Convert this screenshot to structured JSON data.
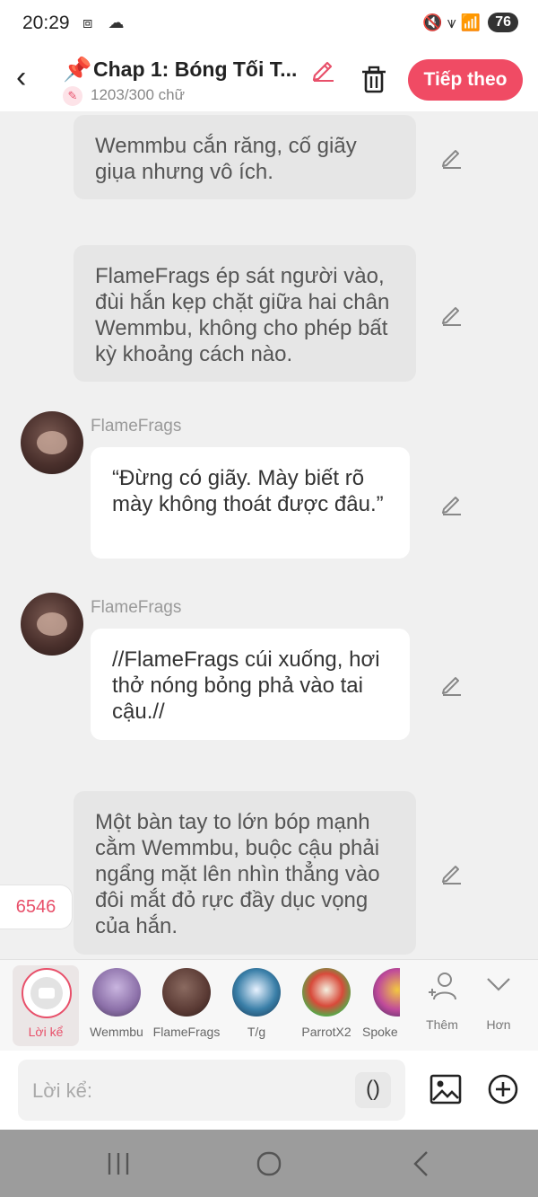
{
  "status": {
    "time": "20:29",
    "left_icons": "⧈ ☁",
    "battery": "76",
    "right_icons": "🔇 ⩛ 📶"
  },
  "header": {
    "back_icon": "‹",
    "pin_icon": "📌",
    "title": "Chap 1: Bóng Tối T...",
    "word_count": "1203/300 chữ",
    "next_label": "Tiếp theo"
  },
  "messages": [
    {
      "type": "narration",
      "text": "Wemmbu cắn răng, cố giãy giụa nhưng vô ích."
    },
    {
      "type": "narration",
      "text": "FlameFrags ép sát người vào, đùi hắn kẹp chặt giữa hai chân Wemmbu, không cho phép bất kỳ khoảng cách nào."
    },
    {
      "type": "character",
      "name": "FlameFrags",
      "text": "“Đừng có giãy. Mày biết rõ mày không thoát được đâu.”"
    },
    {
      "type": "character",
      "name": "FlameFrags",
      "text": "//FlameFrags cúi xuống, hơi thở nóng bỏng phả vào tai cậu.//"
    },
    {
      "type": "narration",
      "text": "Một bàn tay to lớn bóp mạnh cằm Wemmbu, buộc cậu phải ngẩng mặt lên nhìn thẳng vào đôi mắt đỏ rực đầy dục vọng của hắn."
    }
  ],
  "counter": "6546",
  "characters": {
    "narrator_label": "Lời kể",
    "items": [
      {
        "label": "Wemmbu",
        "color": "#8b6fa8"
      },
      {
        "label": "FlameFrags",
        "color": "#5a3a34"
      },
      {
        "label": "T/g",
        "color": "#3a7fa8"
      },
      {
        "label": "ParrotX2",
        "color": "#4fae4a"
      },
      {
        "label": "Spoke",
        "color": "#c04a9a"
      }
    ],
    "add_label": "Thêm",
    "more_label": "Hơn"
  },
  "input": {
    "placeholder": "Lời kể:",
    "paren_label": "()"
  }
}
